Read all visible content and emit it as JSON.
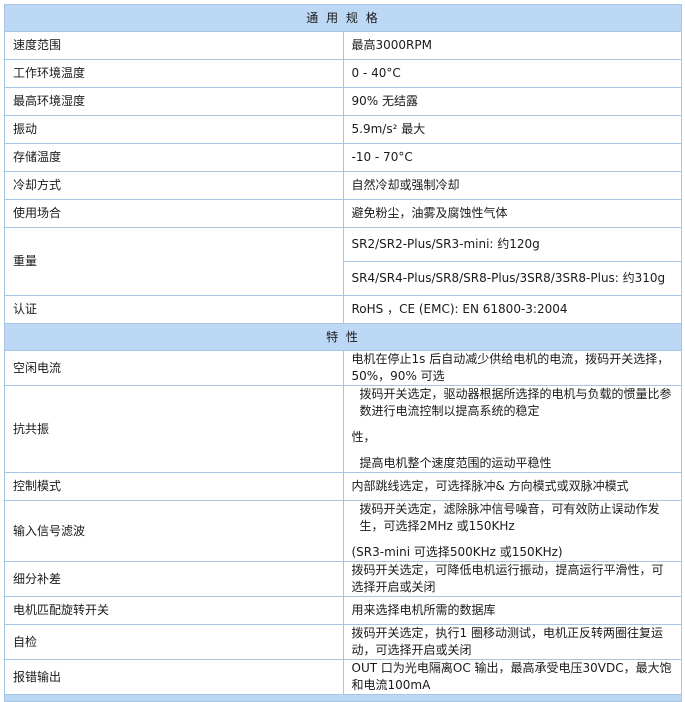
{
  "general": {
    "title": "通 用 规 格",
    "rows": [
      {
        "label": "速度范围",
        "value": "最高3000RPM"
      },
      {
        "label": "工作环境温度",
        "value": "0 - 40°C"
      },
      {
        "label": "最高环境湿度",
        "value": "90% 无结露"
      },
      {
        "label": "振动",
        "value": "5.9m/s² 最大"
      },
      {
        "label": "存储温度",
        "value": "-10 - 70°C"
      },
      {
        "label": "冷却方式",
        "value": "自然冷却或强制冷却"
      },
      {
        "label": "使用场合",
        "value": "避免粉尘，油雾及腐蚀性气体"
      }
    ],
    "weight": {
      "label": "重量",
      "value_1": "SR2/SR2-Plus/SR3-mini: 约120g",
      "value_2": "SR4/SR4-Plus/SR8/SR8-Plus/3SR8/3SR8-Plus: 约310g"
    },
    "certification": {
      "label": "认证",
      "value": "RoHS ，CE (EMC): EN 61800-3:2004"
    }
  },
  "features": {
    "title": "特    性",
    "idle_current": {
      "label": "空闲电流",
      "value": "电机在停止1s 后自动减少供给电机的电流，拨码开关选择，50%，90% 可选"
    },
    "anti_resonance": {
      "label": "抗共振",
      "line_1": "拨码开关选定，驱动器根据所选择的电机与负载的惯量比参数进行电流控制以提高系统的稳定",
      "line_2": "性，",
      "line_3": "提高电机整个速度范围的运动平稳性"
    },
    "control_mode": {
      "label": "控制模式",
      "value": "内部跳线选定，可选择脉冲& 方向模式或双脉冲模式"
    },
    "input_filter": {
      "label": "输入信号滤波",
      "line_1": "拨码开关选定，滤除脉冲信号噪音，可有效防止误动作发生，可选择2MHz 或150KHz",
      "line_2": "(SR3-mini 可选择500KHz 或150KHz)"
    },
    "microstep": {
      "label": "细分补差",
      "value": "拨码开关选定，可降低电机运行振动，提高运行平滑性，可选择开启或关闭"
    },
    "motor_match": {
      "label": "电机匹配旋转开关",
      "value": "用来选择电机所需的数据库"
    },
    "self_test": {
      "label": "自检",
      "value": "拨码开关选定，执行1 圈移动测试，电机正反转两圈往复运动，可选择开启或关闭"
    },
    "alarm_output": {
      "label": "报错输出",
      "value": "OUT 口为光电隔离OC 输出，最高承受电压30VDC，最大饱和电流100mA"
    }
  }
}
